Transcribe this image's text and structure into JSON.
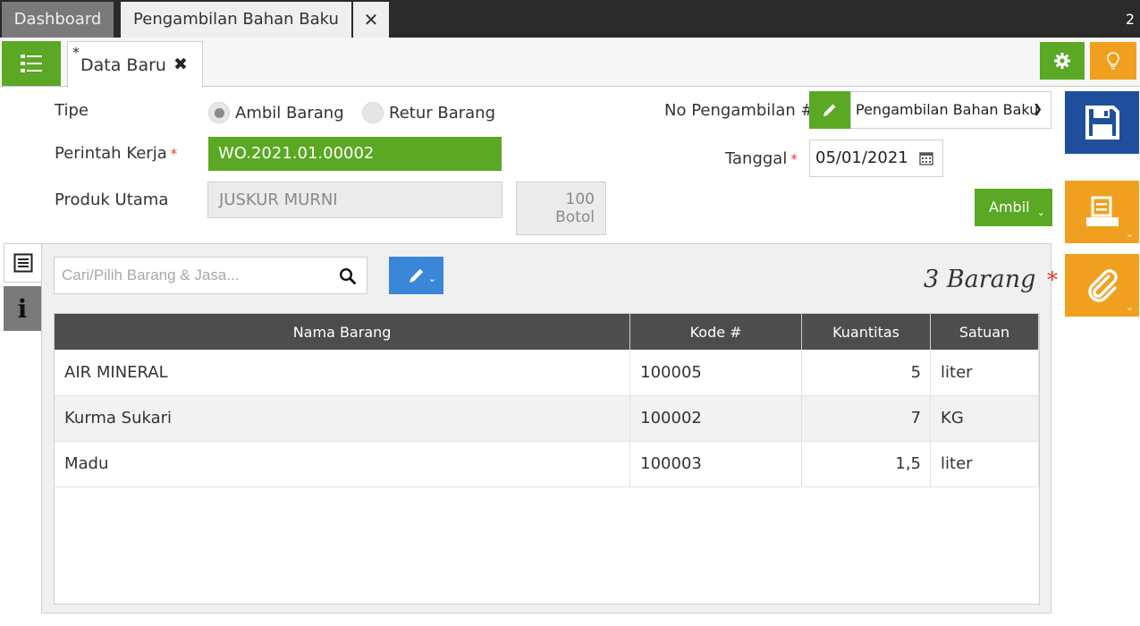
{
  "window": {
    "tabs": [
      {
        "label": "Dashboard",
        "active": false
      },
      {
        "label": "Pengambilan Bahan Baku",
        "active": true
      }
    ],
    "count": "2"
  },
  "subbar": {
    "doc_tab_marker": "*",
    "doc_tab_label": "Data Baru"
  },
  "form": {
    "tipe_label": "Tipe",
    "tipe_options": [
      "Ambil Barang",
      "Retur Barang"
    ],
    "tipe_selected": "Ambil Barang",
    "perintah_kerja_label": "Perintah Kerja",
    "perintah_kerja_value": "WO.2021.01.00002",
    "produk_utama_label": "Produk Utama",
    "produk_utama_value": "JUSKUR MURNI",
    "produk_qty": "100",
    "produk_unit": "Botol",
    "no_pengambilan_label": "No Pengambilan #",
    "no_pengambilan_value": "Pengambilan Bahan Baku",
    "tanggal_label": "Tanggal",
    "tanggal_value": "05/01/2021",
    "required_mark": "*",
    "ambil_label": "Ambil"
  },
  "items": {
    "search_placeholder": "Cari/Pilih Barang & Jasa...",
    "count_label": "3 Barang",
    "columns": [
      "Nama Barang",
      "Kode #",
      "Kuantitas",
      "Satuan"
    ],
    "rows": [
      {
        "nama": "AIR MINERAL",
        "kode": "100005",
        "qty": "5",
        "satuan": "liter"
      },
      {
        "nama": "Kurma Sukari",
        "kode": "100002",
        "qty": "7",
        "satuan": "KG"
      },
      {
        "nama": "Madu",
        "kode": "100003",
        "qty": "1,5",
        "satuan": "liter"
      }
    ]
  },
  "icons": {
    "menu": "list-icon",
    "settings": "gear-icon",
    "tips": "lightbulb-icon",
    "save": "floppy-disk-icon",
    "print": "printer-icon",
    "attach": "paperclip-icon",
    "edit": "pencil-icon",
    "search": "search-icon",
    "calendar": "calendar-icon",
    "info": "info-icon",
    "document": "document-icon"
  },
  "colors": {
    "green": "#5aa823",
    "blue_save": "#1f4e9c",
    "orange": "#f0a01e",
    "blue_edit": "#3a86d8",
    "dark_bar": "#2b2b2b",
    "table_header": "#4d4d4d",
    "required": "#e53935"
  }
}
